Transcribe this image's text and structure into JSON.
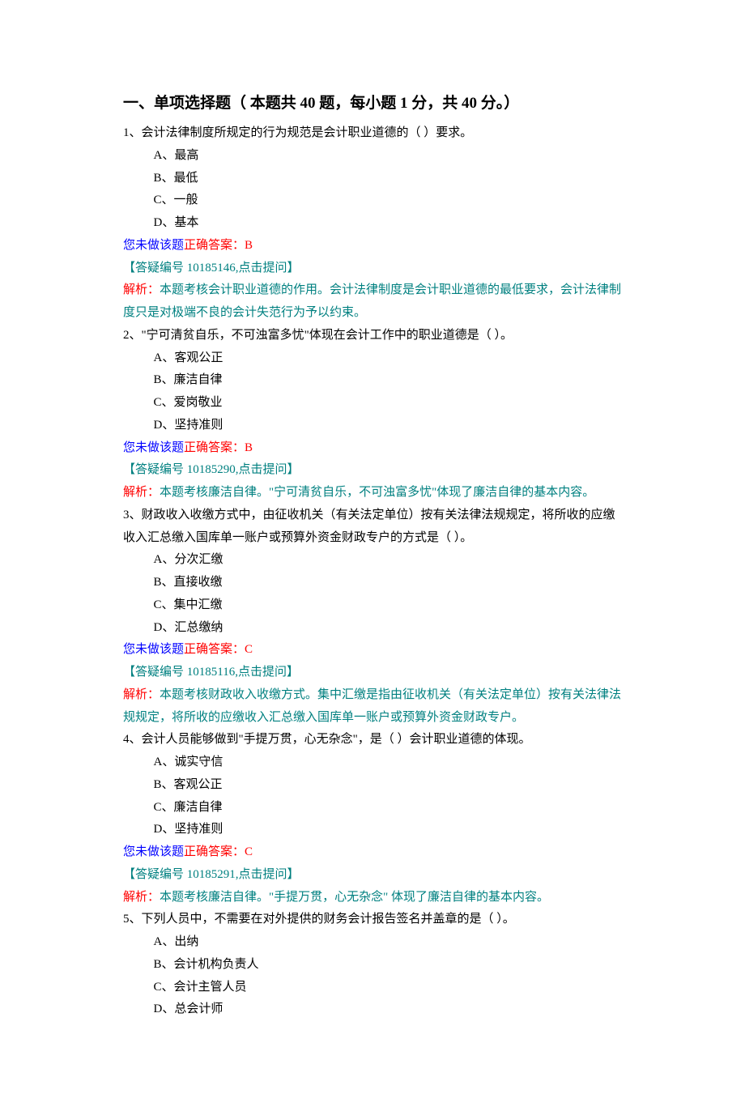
{
  "section": {
    "title": "一、单项选择题（ 本题共 40 题，每小题 1 分，共 40 分。）"
  },
  "status_not_done": "您未做该题",
  "correct_answer_label": "正确答案：",
  "ref_prefix": "【答疑编号 ",
  "ref_suffix": ",点击提问】",
  "analysis_label": "解析：",
  "questions": [
    {
      "num": "1、",
      "text": "会计法律制度所规定的行为规范是会计职业道德的（ ）要求。",
      "options": [
        "A、最高",
        "B、最低",
        "C、一般",
        "D、基本"
      ],
      "answer": "B",
      "ref": "10185146",
      "analysis": "本题考核会计职业道德的作用。会计法律制度是会计职业道德的最低要求，会计法律制度只是对极端不良的会计失范行为予以约束。"
    },
    {
      "num": "2、",
      "text": "\"宁可清贫自乐，不可浊富多忧\"体现在会计工作中的职业道德是（ ）。",
      "options": [
        "A、客观公正",
        "B、廉洁自律",
        "C、爱岗敬业",
        "D、坚持准则"
      ],
      "answer": "B",
      "ref": "10185290",
      "analysis": "本题考核廉洁自律。\"宁可清贫自乐，不可浊富多忧\"体现了廉洁自律的基本内容。"
    },
    {
      "num": "3、",
      "text": "财政收入收缴方式中，由征收机关（有关法定单位）按有关法律法规规定，将所收的应缴收入汇总缴入国库单一账户或预算外资金财政专户的方式是（ ）。",
      "options": [
        "A、分次汇缴",
        "B、直接收缴",
        "C、集中汇缴",
        "D、汇总缴纳"
      ],
      "answer": "C",
      "ref": "10185116",
      "analysis": "本题考核财政收入收缴方式。集中汇缴是指由征收机关（有关法定单位）按有关法律法规规定，将所收的应缴收入汇总缴入国库单一账户或预算外资金财政专户。"
    },
    {
      "num": "4、",
      "text": "会计人员能够做到\"手提万贯，心无杂念\"，是（ ）会计职业道德的体现。",
      "options": [
        "A、诚实守信",
        "B、客观公正",
        "C、廉洁自律",
        "D、坚持准则"
      ],
      "answer": "C",
      "ref": "10185291",
      "analysis": "本题考核廉洁自律。\"手提万贯，心无杂念\" 体现了廉洁自律的基本内容。"
    },
    {
      "num": "5、",
      "text": "下列人员中，不需要在对外提供的财务会计报告签名并盖章的是（ ）。",
      "options": [
        "A、出纳",
        "B、会计机构负责人",
        "C、会计主管人员",
        "D、总会计师"
      ],
      "answer": "",
      "ref": "",
      "analysis": ""
    }
  ]
}
